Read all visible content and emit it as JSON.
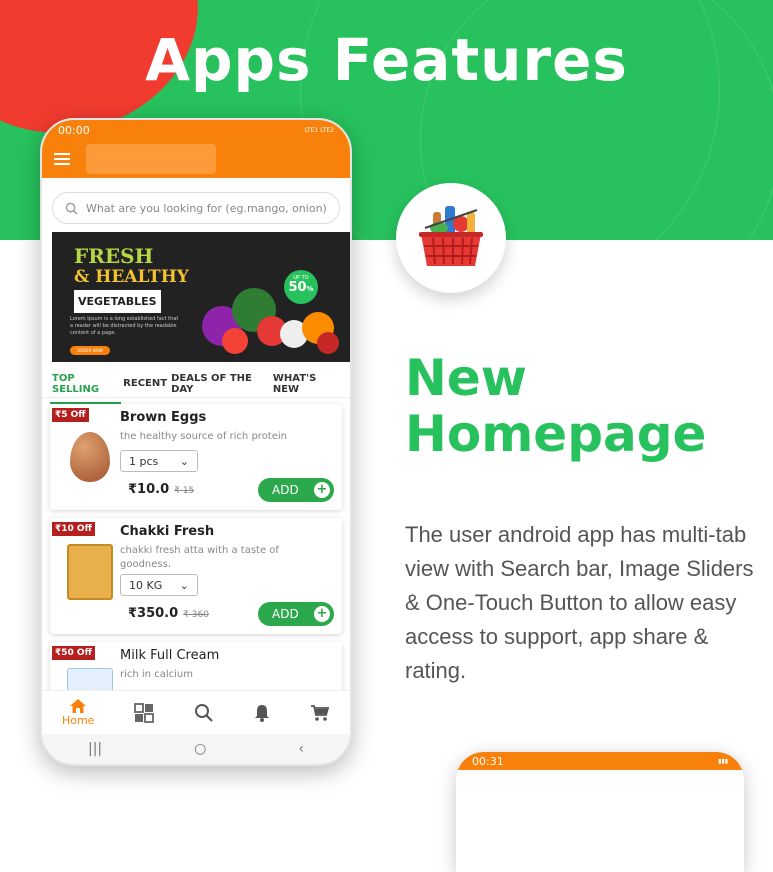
{
  "page": {
    "headline": "Apps Features",
    "feature_title_line1": "New",
    "feature_title_line2": "Homepage",
    "feature_description": "The user android app has multi-tab view with Search bar, Image Sliders & One-Touch Button to allow easy access to support, app share & rating."
  },
  "colors": {
    "hero_green": "#27c25d",
    "accent_red": "#f23b2f",
    "app_orange": "#f7810a",
    "add_green": "#2ca84c",
    "offer_red": "#b5201e"
  },
  "phone": {
    "status_time": "00:00",
    "status_right": "LTE1 LTE2",
    "search_placeholder": "What are you looking for (eg.mango, onion)",
    "banner": {
      "line1": "FRESH",
      "line2": "& HEALTHY",
      "line3": "VEGETABLES",
      "lorem": "Lorem Ipsum is a long established fact that a reader will be distracted by the readable content of a page.",
      "order_label": "ORDER NOW",
      "badge_top": "UP TO",
      "badge_value": "50",
      "badge_unit": "%"
    },
    "tabs": [
      "TOP SELLING",
      "RECENT",
      "DEALS OF THE DAY",
      "WHAT'S NEW"
    ],
    "products": [
      {
        "offer": "₹5 Off",
        "name": "Brown Eggs",
        "desc": "the healthy source of rich protein",
        "qty": "1 pcs",
        "price": "₹10.0",
        "mrp": "₹ 15",
        "add": "ADD"
      },
      {
        "offer": "₹10 Off",
        "name": "Chakki Fresh",
        "desc": "chakki fresh atta with a taste of goodness.",
        "qty": "10 KG",
        "price": "₹350.0",
        "mrp": "₹ 360",
        "add": "ADD"
      },
      {
        "offer": "₹50 Off",
        "name": "Milk Full Cream",
        "desc": "rich in calcium",
        "qty": "",
        "price": "",
        "mrp": "",
        "add": ""
      }
    ],
    "bottom_nav": {
      "home_label": "Home"
    }
  },
  "phone2": {
    "status_time": "00:31"
  }
}
